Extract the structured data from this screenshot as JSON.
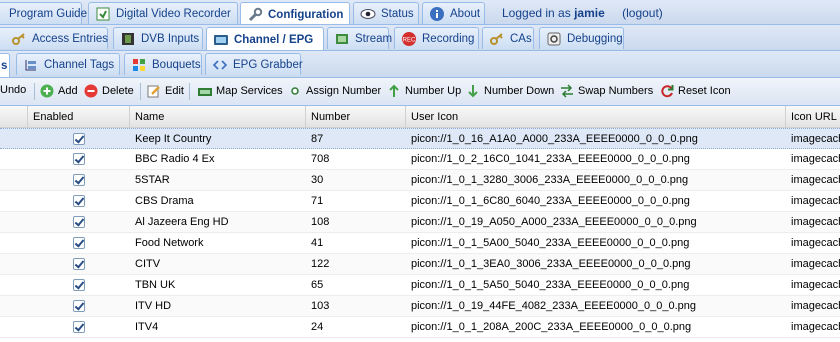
{
  "top_tabs": [
    {
      "label": "Program Guide",
      "icon": "program-guide-icon"
    },
    {
      "label": "Digital Video Recorder",
      "icon": "dvr-icon"
    },
    {
      "label": "Configuration",
      "icon": "wrench-icon"
    },
    {
      "label": "Status",
      "icon": "eye-icon"
    },
    {
      "label": "About",
      "icon": "info-icon"
    }
  ],
  "login": {
    "prefix": "Logged in as",
    "user": "jamie",
    "logout": "(logout)"
  },
  "config_tabs": [
    {
      "label": "Access Entries",
      "icon": "key-icon"
    },
    {
      "label": "DVB Inputs",
      "icon": "film-icon"
    },
    {
      "label": "Channel / EPG",
      "icon": "tv-icon"
    },
    {
      "label": "Stream",
      "icon": "stream-icon"
    },
    {
      "label": "Recording",
      "icon": "rec-icon"
    },
    {
      "label": "CAs",
      "icon": "key-icon"
    },
    {
      "label": "Debugging",
      "icon": "debug-icon"
    }
  ],
  "sub_tabs": [
    {
      "label": "s",
      "icon": ""
    },
    {
      "label": "Channel Tags",
      "icon": "tags-icon"
    },
    {
      "label": "Bouquets",
      "icon": "bouquets-icon"
    },
    {
      "label": "EPG Grabber",
      "icon": "code-icon"
    }
  ],
  "toolbar": {
    "undo": "Undo",
    "add": "Add",
    "delete": "Delete",
    "edit": "Edit",
    "map_services": "Map Services",
    "assign_number": "Assign Number",
    "number_up": "Number Up",
    "number_down": "Number Down",
    "swap_numbers": "Swap Numbers",
    "reset_icon": "Reset Icon"
  },
  "columns": {
    "enabled": "Enabled",
    "name": "Name",
    "number": "Number",
    "user_icon": "User Icon",
    "icon_url": "Icon URL"
  },
  "rows": [
    {
      "name": "Keep It Country",
      "number": "87",
      "user_icon": "picon://1_0_16_A1A0_A000_233A_EEEE0000_0_0_0.png",
      "icon_url": "imagecach"
    },
    {
      "name": "BBC Radio 4 Ex",
      "number": "708",
      "user_icon": "picon://1_0_2_16C0_1041_233A_EEEE0000_0_0_0.png",
      "icon_url": "imagecach"
    },
    {
      "name": "5STAR",
      "number": "30",
      "user_icon": "picon://1_0_1_3280_3006_233A_EEEE0000_0_0_0.png",
      "icon_url": "imagecach"
    },
    {
      "name": "CBS Drama",
      "number": "71",
      "user_icon": "picon://1_0_1_6C80_6040_233A_EEEE0000_0_0_0.png",
      "icon_url": "imagecach"
    },
    {
      "name": "Al Jazeera Eng HD",
      "number": "108",
      "user_icon": "picon://1_0_19_A050_A000_233A_EEEE0000_0_0_0.png",
      "icon_url": "imagecach"
    },
    {
      "name": "Food Network",
      "number": "41",
      "user_icon": "picon://1_0_1_5A00_5040_233A_EEEE0000_0_0_0.png",
      "icon_url": "imagecach"
    },
    {
      "name": "CITV",
      "number": "122",
      "user_icon": "picon://1_0_1_3EA0_3006_233A_EEEE0000_0_0_0.png",
      "icon_url": "imagecach"
    },
    {
      "name": "TBN UK",
      "number": "65",
      "user_icon": "picon://1_0_1_5A50_5040_233A_EEEE0000_0_0_0.png",
      "icon_url": "imagecach"
    },
    {
      "name": "ITV HD",
      "number": "103",
      "user_icon": "picon://1_0_19_44FE_4082_233A_EEEE0000_0_0_0.png",
      "icon_url": "imagecach"
    },
    {
      "name": "ITV4",
      "number": "24",
      "user_icon": "picon://1_0_1_208A_200C_233A_EEEE0000_0_0_0.png",
      "icon_url": "imagecach"
    }
  ]
}
